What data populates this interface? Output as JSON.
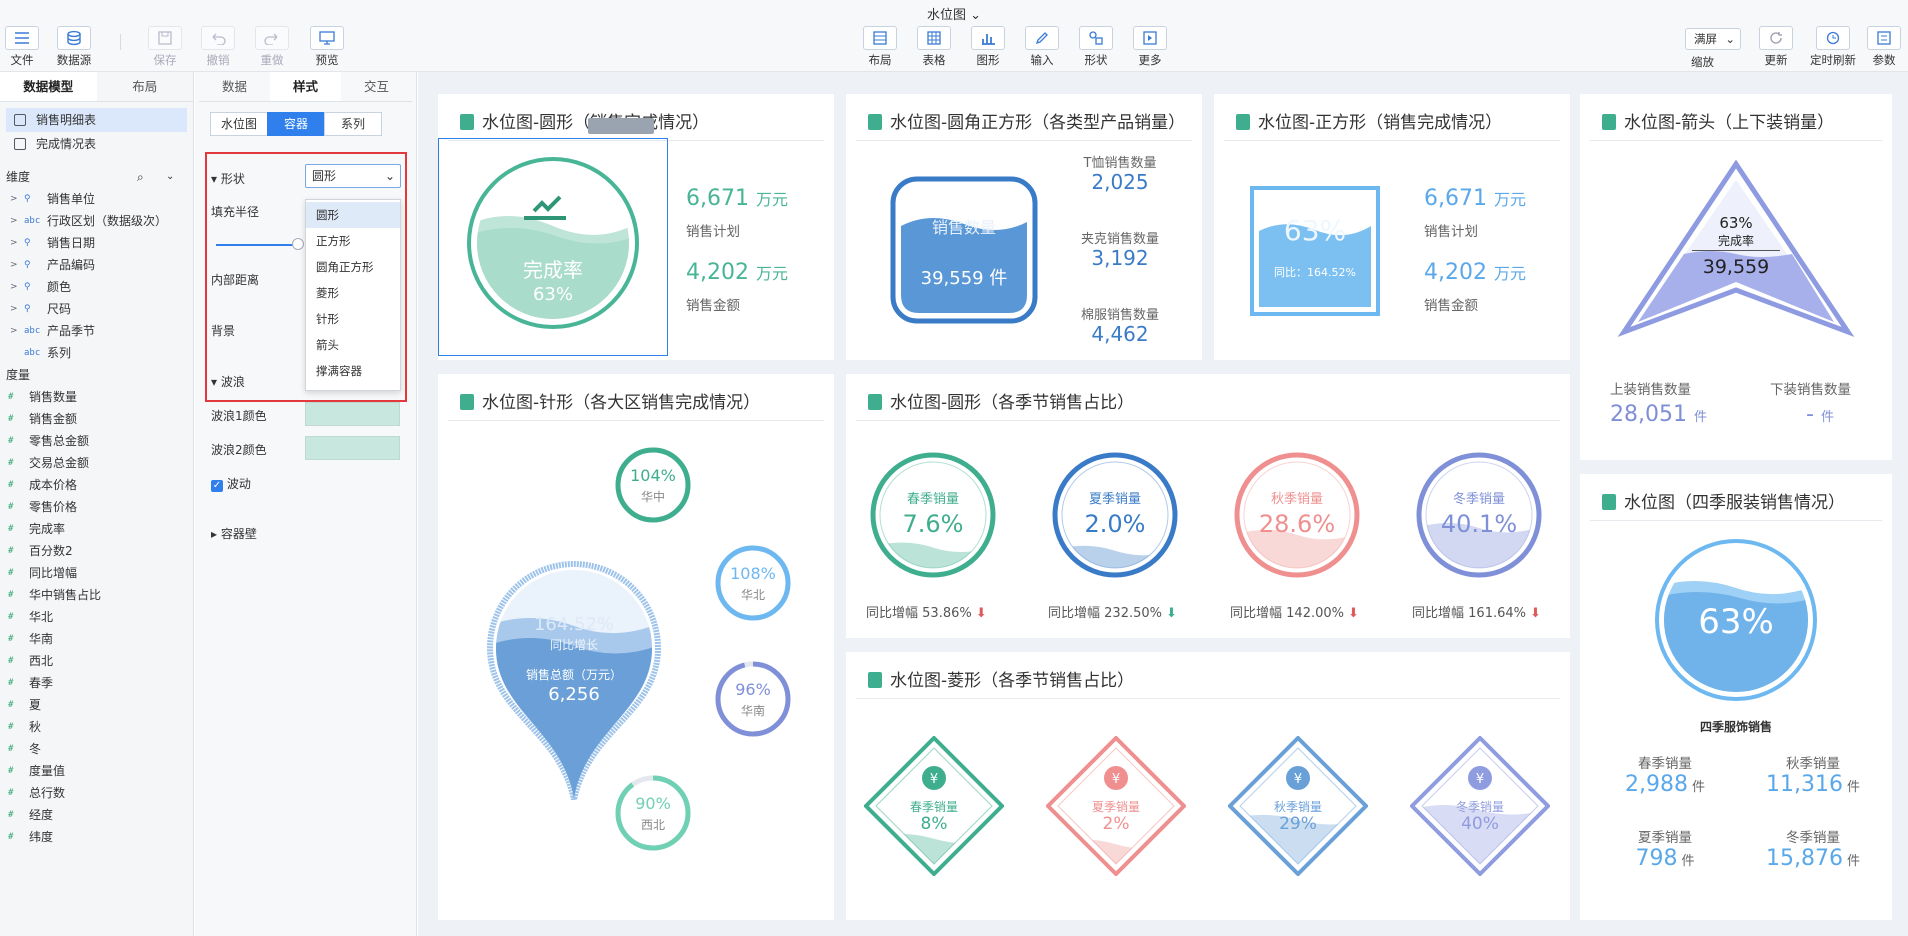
{
  "toolbar": {
    "title": "水位图",
    "file": "文件",
    "datasource": "数据源",
    "save": "保存",
    "undo": "撤销",
    "redo": "重做",
    "preview": "预览",
    "layout": "布局",
    "table": "表格",
    "chart": "图形",
    "input": "输入",
    "shape": "形状",
    "more": "更多",
    "zoom": "满屏",
    "zoom_label": "缩放",
    "refresh": "更新",
    "timer": "定时刷新",
    "params": "参数"
  },
  "left": {
    "tab_model": "数据模型",
    "tab_layout": "布局",
    "tables": [
      "销售明细表",
      "完成情况表"
    ],
    "dim_title": "维度",
    "dimensions": [
      {
        "icon": "⚲",
        "name": "销售单位"
      },
      {
        "icon": "abc",
        "name": "行政区划（数据级次）"
      },
      {
        "icon": "⚲",
        "name": "销售日期"
      },
      {
        "icon": "⚲",
        "name": "产品编码"
      },
      {
        "icon": "⚲",
        "name": "颜色"
      },
      {
        "icon": "⚲",
        "name": "尺码"
      },
      {
        "icon": "abc",
        "name": "产品季节"
      },
      {
        "icon": "abc",
        "name": "系列"
      }
    ],
    "measure_title": "度量",
    "measures": [
      "销售数量",
      "销售金额",
      "零售总金额",
      "交易总金额",
      "成本价格",
      "零售价格",
      "完成率",
      "百分数2",
      "同比增幅",
      "华中销售占比",
      "华北",
      "华南",
      "西北",
      "春季",
      "夏",
      "秋",
      "冬",
      "度量值",
      "总行数",
      "经度",
      "纬度"
    ]
  },
  "mid": {
    "tabs": [
      "数据",
      "样式",
      "交互"
    ],
    "seg": [
      "水位图",
      "容器",
      "系列"
    ],
    "shape_label": "形状",
    "shape_value": "圆形",
    "fill_label": "填充半径",
    "padding_label": "内部距离",
    "bg_label": "背景",
    "wave_label": "波浪",
    "wave1": "波浪1颜色",
    "wave2": "波浪2颜色",
    "wave_anim": "波动",
    "wall": "容器壁",
    "options": [
      "圆形",
      "正方形",
      "圆角正方形",
      "菱形",
      "针形",
      "箭头",
      "撑满容器"
    ]
  },
  "c1": {
    "title": "水位图-圆形（销售完成情况）",
    "label": "完成率",
    "pct": "63%",
    "v1": "6,671",
    "u": "万元",
    "l1": "销售计划",
    "v2": "4,202",
    "l2": "销售金额"
  },
  "c2": {
    "title": "水位图-圆角正方形（各类型产品销量）",
    "inner_label": "销售数量",
    "inner_value": "39,559 件",
    "items": [
      {
        "l": "T恤销售数量",
        "v": "2,025"
      },
      {
        "l": "夹克销售数量",
        "v": "3,192"
      },
      {
        "l": "棉服销售数量",
        "v": "4,462"
      }
    ]
  },
  "c3": {
    "title": "水位图-正方形（销售完成情况）",
    "pct": "63%",
    "sub": "同比：164.52%",
    "v1": "6,671",
    "u": "万元",
    "l1": "销售计划",
    "v2": "4,202",
    "l2": "销售金额"
  },
  "c4": {
    "title": "水位图-箭头（上下装销量）",
    "pct": "63%",
    "label": "完成率",
    "value": "39,559",
    "l1": "上装销售数量",
    "v1": "28,051",
    "u": "件",
    "l2": "下装销售数量",
    "v2": "-"
  },
  "c5": {
    "title": "水位图-针形（各大区销售完成情况）",
    "pin_ghost": "164.52%",
    "pin_ghost_label": "同比增长",
    "pin_label": "销售总额（万元）",
    "pin_value": "6,256",
    "regions": [
      {
        "pct": "104%",
        "name": "华中"
      },
      {
        "pct": "108%",
        "name": "华北"
      },
      {
        "pct": "96%",
        "name": "华南"
      },
      {
        "pct": "90%",
        "name": "西北"
      }
    ]
  },
  "c6": {
    "title": "水位图-圆形（各季节销售占比）",
    "prefix": "同比增幅",
    "items": [
      {
        "name": "春季销量",
        "pct": "7.6%",
        "yoy": "53.86%",
        "color": "#3fae8e"
      },
      {
        "name": "夏季销量",
        "pct": "2.0%",
        "yoy": "232.50%",
        "color": "#3a7bc8"
      },
      {
        "name": "秋季销量",
        "pct": "28.6%",
        "yoy": "142.00%",
        "color": "#ef8f8f"
      },
      {
        "name": "冬季销量",
        "pct": "40.1%",
        "yoy": "161.64%",
        "color": "#7f90d8"
      }
    ]
  },
  "c7": {
    "title": "水位图-菱形（各季节销售占比）",
    "items": [
      {
        "name": "春季销量",
        "pct": "8%",
        "color": "#3fae8e"
      },
      {
        "name": "夏季销量",
        "pct": "2%",
        "color": "#ef8f8f"
      },
      {
        "name": "秋季销量",
        "pct": "29%",
        "color": "#6aa0d8"
      },
      {
        "name": "冬季销量",
        "pct": "40%",
        "color": "#8f9ce0"
      }
    ]
  },
  "c8": {
    "title": "水位图（四季服装销售情况）",
    "pct": "63%",
    "caption": "四季服饰销售",
    "u": "件",
    "items": [
      {
        "l": "春季销量",
        "v": "2,988"
      },
      {
        "l": "秋季销量",
        "v": "11,316"
      },
      {
        "l": "夏季销量",
        "v": "798"
      },
      {
        "l": "冬季销量",
        "v": "15,876"
      }
    ]
  }
}
